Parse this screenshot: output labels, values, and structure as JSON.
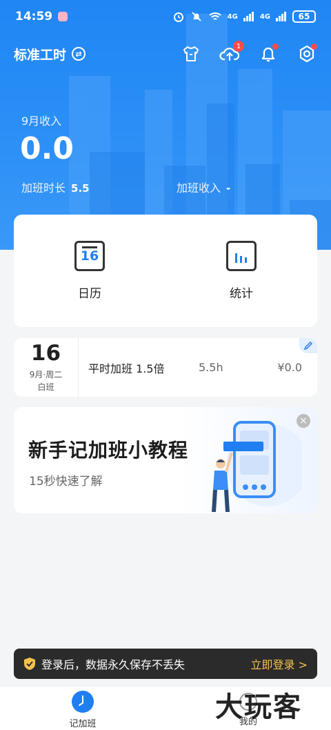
{
  "status_bar": {
    "time": "14:59",
    "network": "4G",
    "network2": "4G",
    "battery": "65"
  },
  "header": {
    "mode_title": "标准工时",
    "upload_badge": "1",
    "icons": [
      "shirt-icon",
      "cloud-upload-icon",
      "bell-icon",
      "settings-icon"
    ]
  },
  "summary": {
    "income_label": "9月收入",
    "income_value": "0.0",
    "ot_hours_label": "加班时长",
    "ot_hours_value": "5.5",
    "ot_income_label": "加班收入",
    "ot_income_value": "-"
  },
  "shortcuts": {
    "calendar_day": "16",
    "calendar_label": "日历",
    "stats_label": "统计"
  },
  "record": {
    "day": "16",
    "week": "9月·周二",
    "shift": "白班",
    "type": "平时加班 1.5倍",
    "hours": "5.5h",
    "money": "¥0.0"
  },
  "tutorial": {
    "title": "新手记加班小教程",
    "subtitle": "15秒快速了解",
    "close": "×"
  },
  "login_bar": {
    "text": "登录后，数据永久保存不丢失",
    "action": "立即登录 >"
  },
  "bottom_nav": {
    "items": [
      {
        "label": "记加班",
        "active": true
      },
      {
        "label": "我的",
        "active": false
      }
    ]
  },
  "watermark": "大玩客",
  "colors": {
    "primary": "#1f7ef1",
    "header_blue": "#2b8ff6",
    "login_accent": "#f6c14b",
    "badge_red": "#ff4b4b"
  }
}
